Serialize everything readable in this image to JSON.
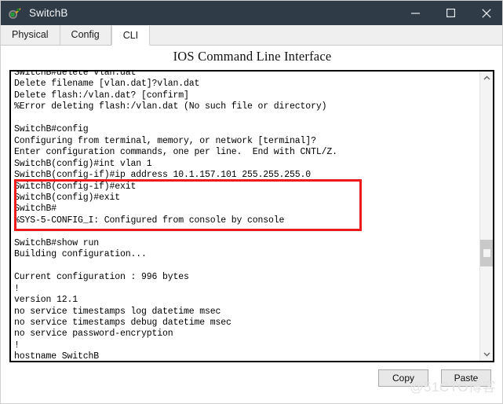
{
  "window": {
    "title": "SwitchB",
    "icon": "packet-tracer-icon",
    "controls": {
      "minimize": "minimize-icon",
      "maximize": "maximize-icon",
      "close": "close-icon"
    }
  },
  "tabs": [
    {
      "label": "Physical",
      "active": false
    },
    {
      "label": "Config",
      "active": false
    },
    {
      "label": "CLI",
      "active": true
    }
  ],
  "panel": {
    "title": "IOS Command Line Interface"
  },
  "terminal": {
    "content": "SwitchB#delete vlan.dat\nDelete filename [vlan.dat]?vlan.dat\nDelete flash:/vlan.dat? [confirm]\n%Error deleting flash:/vlan.dat (No such file or directory)\n\nSwitchB#config\nConfiguring from terminal, memory, or network [terminal]?\nEnter configuration commands, one per line.  End with CNTL/Z.\nSwitchB(config)#int vlan 1\nSwitchB(config-if)#ip address 10.1.157.101 255.255.255.0\nSwitchB(config-if)#exit\nSwitchB(config)#exit\nSwitchB#\n%SYS-5-CONFIG_I: Configured from console by console\n\nSwitchB#show run\nBuilding configuration...\n\nCurrent configuration : 996 bytes\n!\nversion 12.1\nno service timestamps log datetime msec\nno service timestamps debug datetime msec\nno service password-encryption\n!\nhostname SwitchB\n!",
    "highlight_color": "#ef1b1b",
    "highlighted_lines": [
      "SwitchB(config)#int vlan 1",
      "SwitchB(config-if)#ip address 10.1.157.101 255.255.255.0",
      "SwitchB(config-if)#exit",
      "SwitchB(config)#exit",
      "SwitchB#"
    ],
    "scrollbar": {
      "up_arrow": "chevron-up-icon",
      "down_arrow": "chevron-down-icon"
    }
  },
  "footer": {
    "copy_label": "Copy",
    "paste_label": "Paste"
  },
  "watermark": {
    "text": "@51CTO博客"
  }
}
